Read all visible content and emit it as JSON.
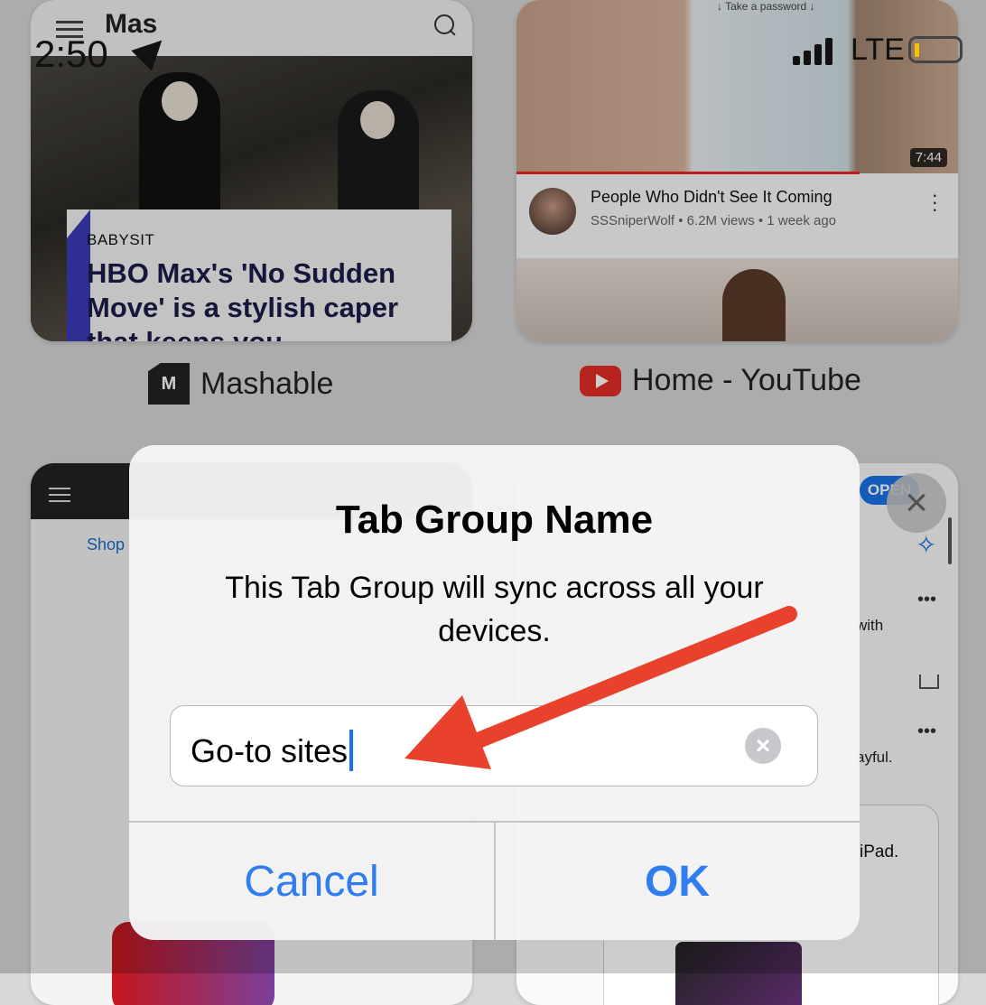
{
  "status_bar": {
    "time": "2:50",
    "network": "LTE"
  },
  "tabs": {
    "mashable": {
      "title": "Mashable",
      "logo_text": "Mas",
      "logo_badge": "M",
      "kicker": "BABYSIT",
      "headline": "HBO Max's 'No Sudden Move' is a stylish caper that keeps you"
    },
    "youtube": {
      "title": "Home - YouTube",
      "take_password": "↓ Take a password ↓",
      "duration": "7:44",
      "video_title": "People Who Didn't See It Coming",
      "video_meta": "SSSniperWolf • 6.2M views • 1 week ago"
    },
    "shop_tab": {
      "link": "Shop"
    },
    "feed_tab": {
      "open_label": "OPEN",
      "text_with": "with",
      "text_playful": "ayful.",
      "ipad_label": "iPad."
    }
  },
  "dialog": {
    "title": "Tab Group Name",
    "message": "This Tab Group will sync across all your devices.",
    "input_value": "Go-to sites",
    "cancel_label": "Cancel",
    "ok_label": "OK"
  },
  "colors": {
    "accent_blue": "#2f7df0",
    "arrow_red": "#e8412c",
    "cursor_blue": "#1a73e8"
  },
  "icons": [
    "menu-icon",
    "search-icon",
    "location-arrow-icon",
    "signal-icon",
    "battery-icon",
    "close-icon",
    "clear-text-icon",
    "more-icon",
    "share-icon",
    "sparkle-icon",
    "mashable-logo",
    "youtube-logo"
  ]
}
